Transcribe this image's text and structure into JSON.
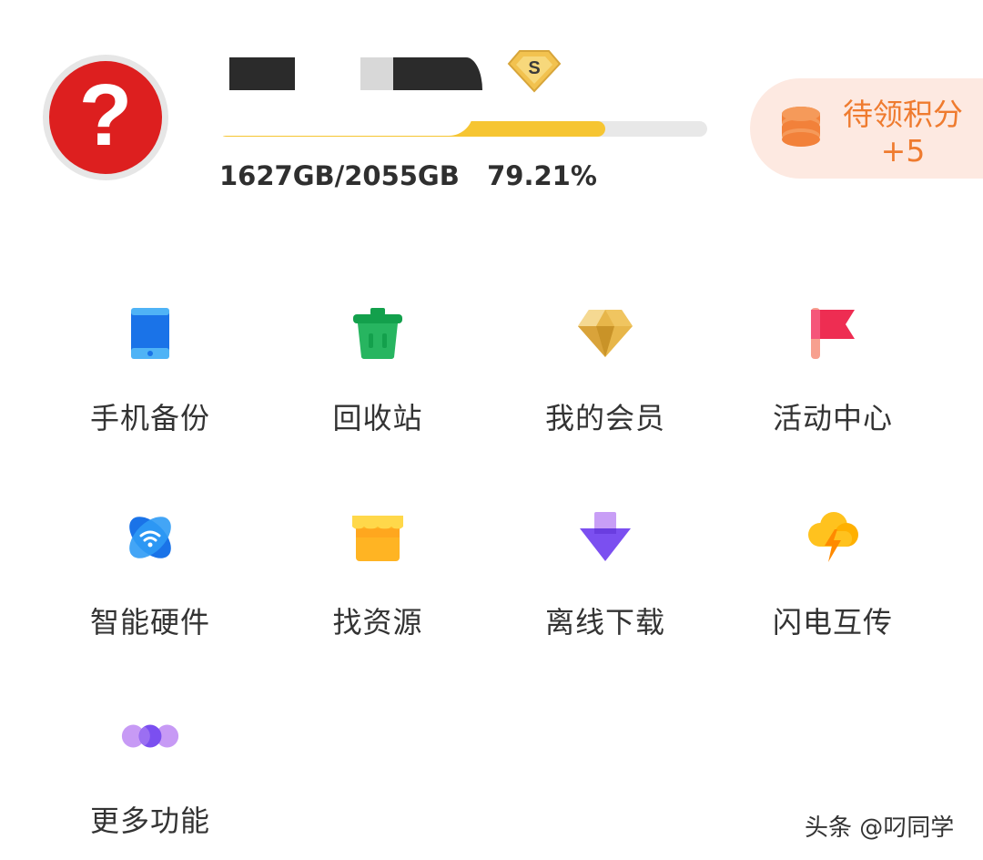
{
  "header": {
    "avatar_glyph": "?",
    "member_badge": "S",
    "storage_progress_percent": 79.21,
    "storage_text": "1627GB/2055GB   79.21%"
  },
  "points_card": {
    "label": "待领积分",
    "value": "+5",
    "color": "#ef7b2f"
  },
  "features": [
    {
      "label": "手机备份",
      "icon": "tablet-icon"
    },
    {
      "label": "回收站",
      "icon": "trash-icon"
    },
    {
      "label": "我的会员",
      "icon": "diamond-icon"
    },
    {
      "label": "活动中心",
      "icon": "flag-icon"
    },
    {
      "label": "智能硬件",
      "icon": "wifi-orbit-icon"
    },
    {
      "label": "找资源",
      "icon": "store-icon"
    },
    {
      "label": "离线下载",
      "icon": "download-arrow-icon"
    },
    {
      "label": "闪电互传",
      "icon": "lightning-cloud-icon"
    },
    {
      "label": "更多功能",
      "icon": "more-circles-icon"
    }
  ],
  "watermark": "头条 @叼同学"
}
